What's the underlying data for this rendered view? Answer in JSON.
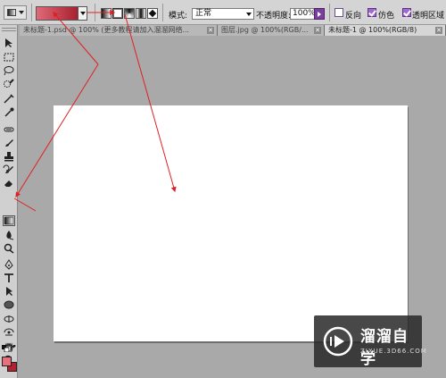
{
  "options_bar": {
    "mode_label": "模式:",
    "mode_value": "正常",
    "opacity_label": "不透明度:",
    "opacity_value": "100%",
    "reverse_label": "反向",
    "reverse_checked": false,
    "dither_label": "仿色",
    "dither_checked": true,
    "transparency_label": "透明区域",
    "transparency_checked": true,
    "gradient_colors": [
      "#e06a78",
      "#a8202f"
    ],
    "gradient_types": [
      "linear-gradient-icon",
      "radial-gradient-icon",
      "angle-gradient-icon",
      "reflected-gradient-icon",
      "diamond-gradient-icon"
    ],
    "selected_gradient_type": "radial-gradient-icon"
  },
  "tabs": [
    {
      "label": "未标题-1.psd @ 100% (更多教程请加入溜溜网络..."
    },
    {
      "label": "图层.jpg @ 100%(RGB/..."
    },
    {
      "label": "未标题-1 @ 100%(RGB/8)",
      "active": true
    }
  ],
  "toolbox": {
    "selected_tool": "gradient-tool",
    "foreground_color": "#e8707c",
    "background_color": "#b3212e"
  },
  "watermark": {
    "name": "溜溜自学",
    "url": "ZIXUE.3D66.COM"
  },
  "colors": {
    "annotation_arrow": "#e02020",
    "workspace": "#a9a9a9"
  }
}
